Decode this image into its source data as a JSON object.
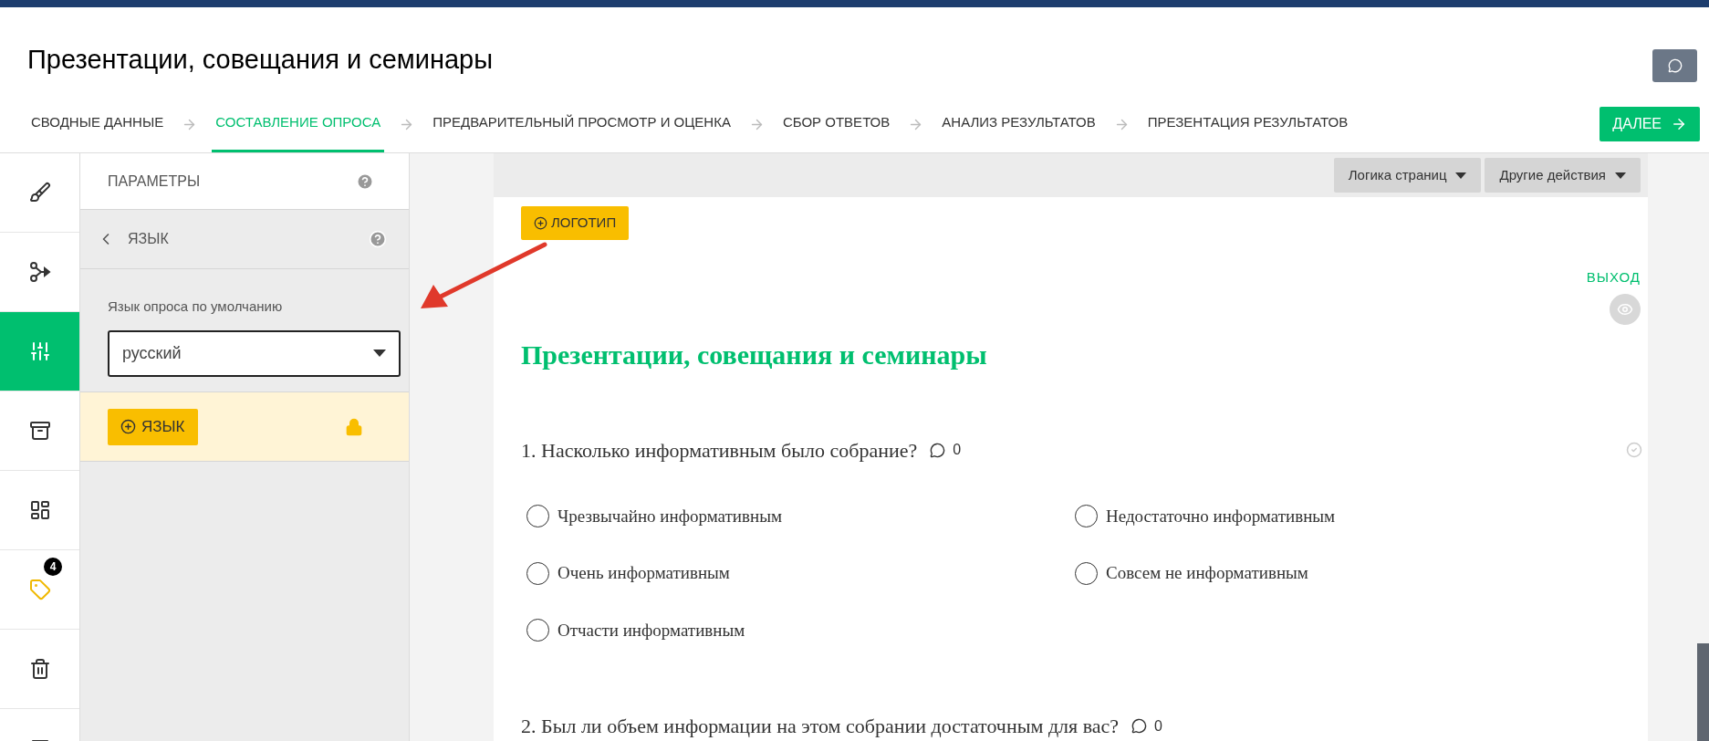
{
  "header": {
    "title": "Презентации, совещания и семинары"
  },
  "steps": [
    {
      "label": "СВОДНЫЕ ДАННЫЕ",
      "selected": false
    },
    {
      "label": "СОСТАВЛЕНИЕ ОПРОСА",
      "selected": true
    },
    {
      "label": "ПРЕДВАРИТЕЛЬНЫЙ ПРОСМОТР И ОЦЕНКА",
      "selected": false
    },
    {
      "label": "СБОР ОТВЕТОВ",
      "selected": false
    },
    {
      "label": "АНАЛИЗ РЕЗУЛЬТАТОВ",
      "selected": false
    },
    {
      "label": "ПРЕЗЕНТАЦИЯ РЕЗУЛЬТАТОВ",
      "selected": false
    }
  ],
  "next_button": "ДАЛЕЕ",
  "rail": [
    {
      "kind": "brush",
      "selected": false
    },
    {
      "kind": "logic",
      "selected": false
    },
    {
      "kind": "sliders",
      "selected": true
    },
    {
      "kind": "box",
      "selected": false
    },
    {
      "kind": "layout",
      "selected": false
    },
    {
      "kind": "tag",
      "selected": false,
      "badge": "4"
    },
    {
      "kind": "trash",
      "selected": false
    },
    {
      "kind": "more",
      "selected": false
    }
  ],
  "panel": {
    "title": "ПАРАМЕТРЫ",
    "section": "ЯЗЫК",
    "field_label": "Язык опроса по умолчанию",
    "field_value": "русский",
    "add_button": "ЯЗЫК",
    "locked": true
  },
  "toolbar": [
    "Логика страниц",
    "Другие действия"
  ],
  "survey": {
    "logo_button": "ЛОГОТИП",
    "exit": "ВЫХОД",
    "title": "Презентации, совещания и семинары",
    "questions": [
      {
        "text": "1. Насколько информативным было собрание?",
        "comments": "0",
        "options": [
          {
            "label": "Чрезвычайно информативным",
            "selected": false
          },
          {
            "label": "Недостаточно информативным",
            "selected": false
          },
          {
            "label": "Очень информативным",
            "selected": false
          },
          {
            "label": "Совсем не информативным",
            "selected": false
          },
          {
            "label": "Отчасти информативным",
            "selected": false
          }
        ]
      },
      {
        "text": "2. Был ли объем информации на этом собрании достаточным для вас?",
        "comments": "0"
      }
    ]
  }
}
